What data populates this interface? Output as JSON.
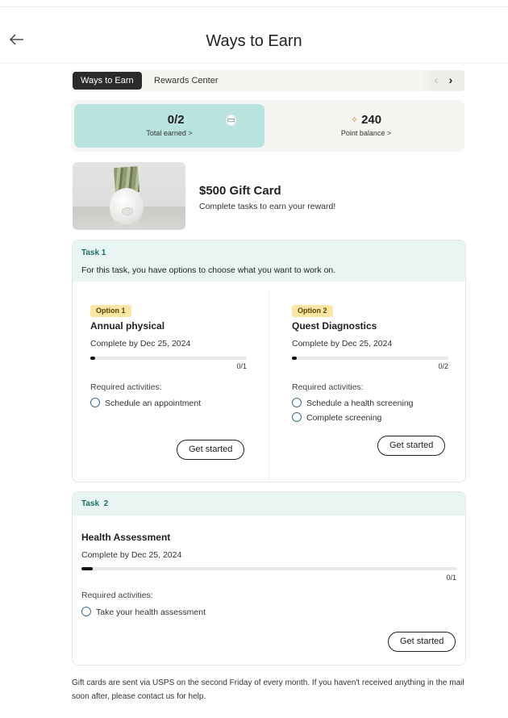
{
  "header": {
    "title": "Ways to Earn",
    "back_icon": "arrow-left-icon"
  },
  "tabs": [
    {
      "label": "Ways to Earn",
      "active": true
    },
    {
      "label": "Rewards Center",
      "active": false
    }
  ],
  "tab_arrows": {
    "prev": "‹",
    "next": "›"
  },
  "stats": {
    "earned": {
      "value": "0/2",
      "label": "Total earned >",
      "icon": "gift-card-icon"
    },
    "points": {
      "value": "240",
      "label": "Point balance >",
      "icon": "sparkle-icon"
    }
  },
  "reward": {
    "title": "$500 Gift Card",
    "description": "Complete tasks to earn your reward!",
    "image": "piggy-bank-with-cash"
  },
  "task1": {
    "label": "Task 1",
    "description": "For this task, you have options to choose what you want to work on.",
    "options": [
      {
        "badge": "Option 1",
        "title": "Annual physical",
        "due": "Complete by Dec 25, 2024",
        "progress_count": "0/1",
        "progress_fraction": 0.02,
        "required_label": "Required activities:",
        "activities": [
          "Schedule an appointment"
        ],
        "button": "Get started"
      },
      {
        "badge": "Option 2",
        "title": "Quest Diagnostics",
        "due": "Complete by Dec 25, 2024",
        "progress_count": "0/2",
        "progress_fraction": 0.02,
        "required_label": "Required activities:",
        "activities": [
          "Schedule a health screening",
          "Complete screening"
        ],
        "button": "Get started"
      }
    ]
  },
  "task2": {
    "label": "Task  2",
    "title": "Health Assessment",
    "due": "Complete by Dec 25, 2024",
    "progress_count": "0/1",
    "progress_fraction": 0.03,
    "required_label": "Required activities:",
    "activities": [
      "Take your health assessment"
    ],
    "button": "Get started"
  },
  "footer_note": "Gift cards are sent via USPS on the second Friday of every month. If you  haven't received anything in the mail soon after, please contact us for help.",
  "colors": {
    "accent_teal": "#b9e3de",
    "task_header": "#e9f5f3",
    "badge_yellow": "#fbe6a6",
    "dark": "#2b2b2b"
  }
}
